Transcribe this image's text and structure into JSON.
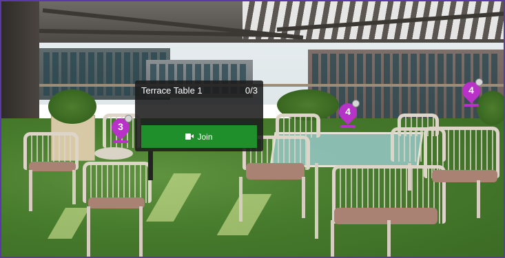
{
  "room_popup": {
    "title": "Terrace Table 1",
    "occupancy": "0/3",
    "join_label": "Join",
    "join_icon": "video-camera-icon",
    "join_color": "#1f8f2c"
  },
  "markers": [
    {
      "label": "3",
      "color": "#b832c8"
    },
    {
      "label": "4",
      "color": "#b832c8"
    },
    {
      "label": "4",
      "color": "#b832c8"
    }
  ]
}
